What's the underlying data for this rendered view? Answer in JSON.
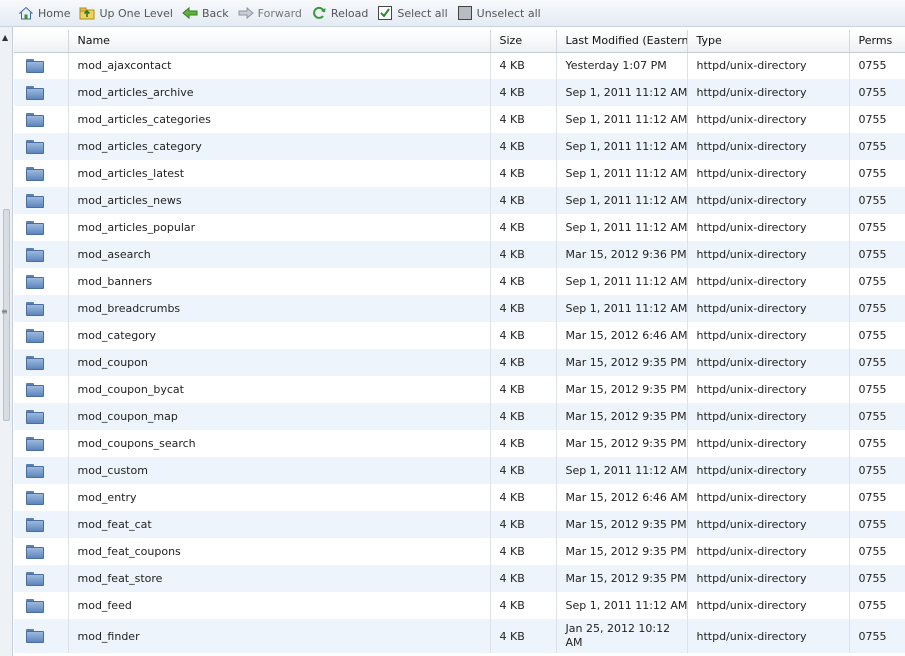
{
  "toolbar": {
    "home": "Home",
    "up_one_level": "Up One Level",
    "back": "Back",
    "forward": "Forward",
    "reload": "Reload",
    "select_all": "Select all",
    "unselect_all": "Unselect all"
  },
  "columns": {
    "name": "Name",
    "size": "Size",
    "modified": "Last Modified (Eastern Da",
    "type": "Type",
    "perms": "Perms"
  },
  "rows": [
    {
      "name": "mod_ajaxcontact",
      "size": "4 KB",
      "modified": "Yesterday 1:07 PM",
      "type": "httpd/unix-directory",
      "perms": "0755"
    },
    {
      "name": "mod_articles_archive",
      "size": "4 KB",
      "modified": "Sep 1, 2011 11:12 AM",
      "type": "httpd/unix-directory",
      "perms": "0755"
    },
    {
      "name": "mod_articles_categories",
      "size": "4 KB",
      "modified": "Sep 1, 2011 11:12 AM",
      "type": "httpd/unix-directory",
      "perms": "0755"
    },
    {
      "name": "mod_articles_category",
      "size": "4 KB",
      "modified": "Sep 1, 2011 11:12 AM",
      "type": "httpd/unix-directory",
      "perms": "0755"
    },
    {
      "name": "mod_articles_latest",
      "size": "4 KB",
      "modified": "Sep 1, 2011 11:12 AM",
      "type": "httpd/unix-directory",
      "perms": "0755"
    },
    {
      "name": "mod_articles_news",
      "size": "4 KB",
      "modified": "Sep 1, 2011 11:12 AM",
      "type": "httpd/unix-directory",
      "perms": "0755"
    },
    {
      "name": "mod_articles_popular",
      "size": "4 KB",
      "modified": "Sep 1, 2011 11:12 AM",
      "type": "httpd/unix-directory",
      "perms": "0755"
    },
    {
      "name": "mod_asearch",
      "size": "4 KB",
      "modified": "Mar 15, 2012 9:36 PM",
      "type": "httpd/unix-directory",
      "perms": "0755"
    },
    {
      "name": "mod_banners",
      "size": "4 KB",
      "modified": "Sep 1, 2011 11:12 AM",
      "type": "httpd/unix-directory",
      "perms": "0755"
    },
    {
      "name": "mod_breadcrumbs",
      "size": "4 KB",
      "modified": "Sep 1, 2011 11:12 AM",
      "type": "httpd/unix-directory",
      "perms": "0755"
    },
    {
      "name": "mod_category",
      "size": "4 KB",
      "modified": "Mar 15, 2012 6:46 AM",
      "type": "httpd/unix-directory",
      "perms": "0755"
    },
    {
      "name": "mod_coupon",
      "size": "4 KB",
      "modified": "Mar 15, 2012 9:35 PM",
      "type": "httpd/unix-directory",
      "perms": "0755"
    },
    {
      "name": "mod_coupon_bycat",
      "size": "4 KB",
      "modified": "Mar 15, 2012 9:35 PM",
      "type": "httpd/unix-directory",
      "perms": "0755"
    },
    {
      "name": "mod_coupon_map",
      "size": "4 KB",
      "modified": "Mar 15, 2012 9:35 PM",
      "type": "httpd/unix-directory",
      "perms": "0755"
    },
    {
      "name": "mod_coupons_search",
      "size": "4 KB",
      "modified": "Mar 15, 2012 9:35 PM",
      "type": "httpd/unix-directory",
      "perms": "0755"
    },
    {
      "name": "mod_custom",
      "size": "4 KB",
      "modified": "Sep 1, 2011 11:12 AM",
      "type": "httpd/unix-directory",
      "perms": "0755"
    },
    {
      "name": "mod_entry",
      "size": "4 KB",
      "modified": "Mar 15, 2012 6:46 AM",
      "type": "httpd/unix-directory",
      "perms": "0755"
    },
    {
      "name": "mod_feat_cat",
      "size": "4 KB",
      "modified": "Mar 15, 2012 9:35 PM",
      "type": "httpd/unix-directory",
      "perms": "0755"
    },
    {
      "name": "mod_feat_coupons",
      "size": "4 KB",
      "modified": "Mar 15, 2012 9:35 PM",
      "type": "httpd/unix-directory",
      "perms": "0755"
    },
    {
      "name": "mod_feat_store",
      "size": "4 KB",
      "modified": "Mar 15, 2012 9:35 PM",
      "type": "httpd/unix-directory",
      "perms": "0755"
    },
    {
      "name": "mod_feed",
      "size": "4 KB",
      "modified": "Sep 1, 2011 11:12 AM",
      "type": "httpd/unix-directory",
      "perms": "0755"
    },
    {
      "name": "mod_finder",
      "size": "4 KB",
      "modified": "Jan 25, 2012 10:12 AM",
      "type": "httpd/unix-directory",
      "perms": "0755"
    }
  ],
  "icons": {
    "row": "folder-icon",
    "home": "home-icon",
    "up": "folder-up-icon",
    "back": "back-arrow-icon",
    "forward": "forward-arrow-icon",
    "reload": "reload-icon",
    "select_all": "checkbox-checked-icon",
    "unselect_all": "checkbox-unchecked-icon"
  },
  "colors": {
    "row_alt": "#eef4fb",
    "toolbar_bg": "#e4ebf4",
    "folder": "#5d86bd"
  }
}
